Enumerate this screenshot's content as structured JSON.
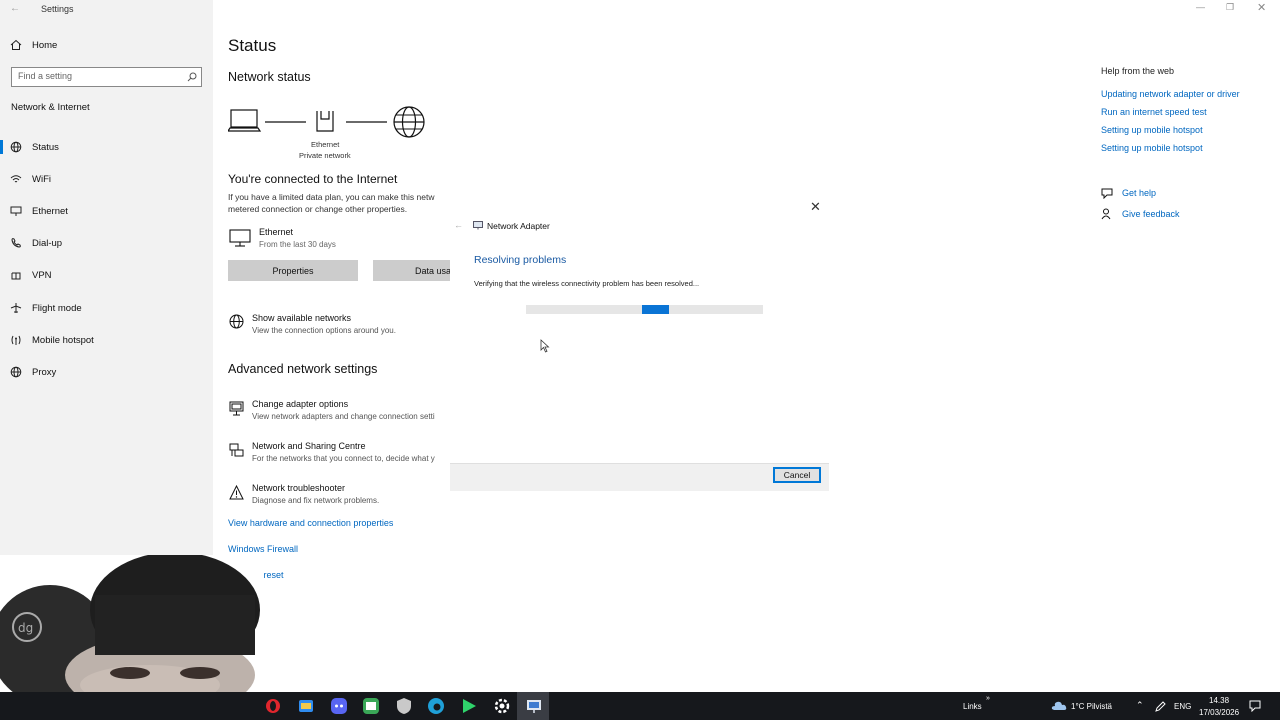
{
  "window": {
    "title": "Settings"
  },
  "sidebar": {
    "home_label": "Home",
    "search_placeholder": "Find a setting",
    "section_title": "Network & Internet",
    "items": [
      {
        "label": "Status",
        "icon": "globe-icon",
        "active": true
      },
      {
        "label": "WiFi",
        "icon": "wifi-icon"
      },
      {
        "label": "Ethernet",
        "icon": "ethernet-icon"
      },
      {
        "label": "Dial-up",
        "icon": "dialup-icon"
      },
      {
        "label": "VPN",
        "icon": "vpn-icon"
      },
      {
        "label": "Flight mode",
        "icon": "airplane-icon"
      },
      {
        "label": "Mobile hotspot",
        "icon": "hotspot-icon"
      },
      {
        "label": "Proxy",
        "icon": "globe-icon"
      }
    ]
  },
  "main": {
    "title": "Status",
    "network_status_heading": "Network status",
    "diagram": {
      "label_1": "Ethernet",
      "label_2": "Private network"
    },
    "connected_heading": "You're connected to the Internet",
    "plan_text_line_1": "If you have a limited data plan, you can make this netw",
    "plan_text_line_2": "metered connection or change other properties.",
    "ethernet": {
      "name": "Ethernet",
      "subtitle": "From the last 30 days"
    },
    "properties_button": "Properties",
    "data_usage_button": "Data usa",
    "show_networks": {
      "title": "Show available networks",
      "subtitle": "View the connection options around you."
    },
    "advanced_heading": "Advanced network settings",
    "advanced_items": [
      {
        "title": "Change adapter options",
        "subtitle": "View network adapters and change connection setti"
      },
      {
        "title": "Network and Sharing Centre",
        "subtitle": "For the networks that you connect to, decide what y"
      },
      {
        "title": "Network troubleshooter",
        "subtitle": "Diagnose and fix network problems."
      }
    ],
    "links": [
      "View hardware and connection properties",
      "Windows Firewall",
      "Network reset"
    ]
  },
  "right_pane": {
    "help_heading": "Help from the web",
    "web_links": [
      "Updating network adapter or driver",
      "Run an internet speed test",
      "Setting up mobile hotspot",
      "Setting up mobile hotspot"
    ],
    "get_help": "Get help",
    "give_feedback": "Give feedback"
  },
  "dialog": {
    "title": "Network Adapter",
    "heading": "Resolving problems",
    "status": "Verifying that the wireless connectivity problem has been resolved...",
    "cancel": "Cancel"
  },
  "taskbar": {
    "apps": [
      "opera-icon",
      "files-icon",
      "discord-icon",
      "terminal-icon",
      "shield-icon",
      "edge-icon",
      "play-icon",
      "settings-icon",
      "troubleshooter-icon"
    ],
    "links_label": "Links",
    "weather": "1°C  Pilvistä",
    "language": "ENG",
    "time": "14.38",
    "date": "17/03/2026"
  },
  "colors": {
    "accent": "#0078d7",
    "link": "#0067c0",
    "sidebar_bg": "#f2f2f2",
    "taskbar_bg": "#16181c"
  }
}
